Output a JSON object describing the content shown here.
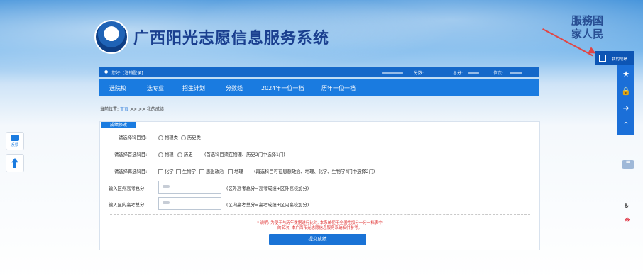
{
  "header": {
    "title": "广西阳光志愿信息服务系统",
    "calligraphy": "服務國家人民"
  },
  "userbar": {
    "greeting": "您好: [注销登录]",
    "score_label": "分数:",
    "total_label": "总分:",
    "rank_label": "位次:"
  },
  "nav": {
    "items": [
      "选院校",
      "选专业",
      "招生计划",
      "分数线",
      "2024年一位一档",
      "历年一位一档"
    ]
  },
  "breadcrumb": {
    "prefix": "当前位置:",
    "home": "首页",
    "sep": ">> >>",
    "current": "我的成绩"
  },
  "form": {
    "tab": "成绩修改",
    "subject_group": {
      "label": "请选择科目组:",
      "options": [
        "物理类",
        "历史类"
      ]
    },
    "primary": {
      "label": "请选择首选科目:",
      "options": [
        "物理",
        "历史"
      ],
      "hint": "(首选科目须在物理、历史2门中选择1门)"
    },
    "secondary": {
      "label": "请选择再选科目:",
      "options": [
        "化学",
        "生物学",
        "思想政治",
        "地理"
      ],
      "hint": "(再选科目可在思想政治、地理、化学、生物学4门中选择2门)"
    },
    "outside_total": {
      "label": "输入区外高考总分:",
      "hint": "(区外高考总分=高考成绩+区外高校加分)"
    },
    "inside_total": {
      "label": "输入区内高考总分:",
      "hint": "(区内高考总分=高考成绩+区内高校加分)"
    },
    "note_line1": "* 说明: 为便于与历年数据进行比对, 本系统使用全国性加分一分一档表中",
    "note_line2": "的名次, 本广西阳光志愿信息服务系统仅供参考。",
    "submit": "提交成绩"
  },
  "right_sidebar": {
    "score_popup": "我的成绩"
  },
  "left_float": {
    "feedback": "反馈"
  },
  "colors": {
    "primary": "#1a7be0",
    "dark_blue": "#1568c9",
    "note_red": "#e03434"
  }
}
